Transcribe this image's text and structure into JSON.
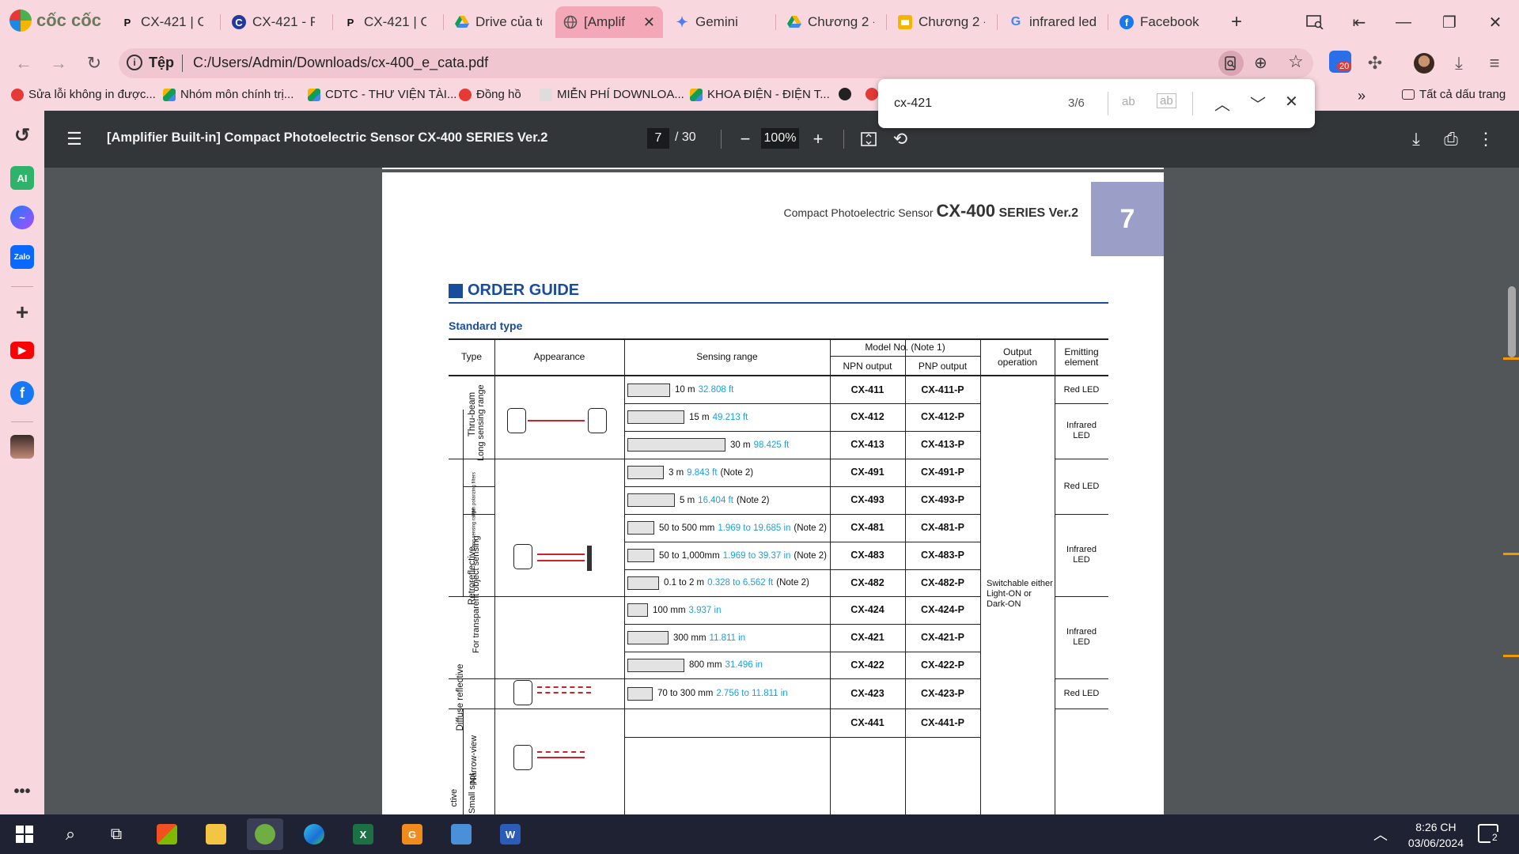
{
  "browser": {
    "logo_text": "cốc cốc",
    "tabs": [
      {
        "label": "CX-421 | Co",
        "icon": "P"
      },
      {
        "label": "CX-421 - Pa",
        "icon": "C"
      },
      {
        "label": "CX-421 | Co",
        "icon": "P"
      },
      {
        "label": "Drive của tô",
        "icon": "drive"
      },
      {
        "label": "[Amplif",
        "icon": "globe",
        "active": true
      },
      {
        "label": "Gemini",
        "icon": "gemini"
      },
      {
        "label": "Chương 2 -",
        "icon": "drive"
      },
      {
        "label": "Chương 2 -",
        "icon": "slides"
      },
      {
        "label": "infrared led",
        "icon": "google"
      },
      {
        "label": "Facebook",
        "icon": "facebook"
      }
    ],
    "address": {
      "site_label": "Tệp",
      "url": "C:/Users/Admin/Downloads/cx-400_e_cata.pdf"
    },
    "extension_badge": "20",
    "bookmarks": [
      "Sửa lỗi không in được...",
      "Nhóm môn chính trị...",
      "CDTC - THƯ VIỆN TÀI...",
      "Đồng hồ",
      "MIỄN PHÍ DOWNLOA...",
      "KHOA ĐIỆN - ĐIỆN T..."
    ],
    "all_bookmarks": "Tất cả dấu trang"
  },
  "find": {
    "query": "cx-421",
    "count": "3/6",
    "opt1": "ab",
    "opt2": "ab"
  },
  "pdf": {
    "title": "[Amplifier Built-in] Compact Photoelectric Sensor CX-400 SERIES Ver.2",
    "page_current": "7",
    "page_total": "/ 30",
    "zoom": "100%"
  },
  "page": {
    "header_small": "Compact Photoelectric Sensor ",
    "header_big": "CX-400",
    "header_series": " SERIES Ver.2",
    "page_number": "7",
    "section_title": "ORDER GUIDE",
    "subsection": "Standard type",
    "columns": {
      "type": "Type",
      "appearance": "Appearance",
      "range": "Sensing range",
      "model": "Model No. (Note 1)",
      "npn": "NPN output",
      "pnp": "PNP output",
      "output": "Output operation",
      "emitting": "Emitting element"
    },
    "groups": {
      "thru": "Thru-beam",
      "long": "Long sensing range",
      "retro": "Retroreflective",
      "polar": "With polarizing filters",
      "longrange": "Long sensing range",
      "transparent": "For transparent object sensing",
      "diffuse": "Diffuse reflective",
      "narrow": "Narrow-view",
      "small": "Small spot",
      "cutoff": "ctive"
    },
    "output_operation": "Switchable either Light-ON or Dark-ON",
    "rows": [
      {
        "range": "10 m",
        "range_ft": "32.808 ft",
        "note": "",
        "npn": "CX-411",
        "pnp": "CX-411-P",
        "bar": 0.27
      },
      {
        "range": "15 m",
        "range_ft": "49.213 ft",
        "note": "",
        "npn": "CX-412",
        "pnp": "CX-412-P",
        "bar": 0.36
      },
      {
        "range": "30 m",
        "range_ft": "98.425 ft",
        "note": "",
        "npn": "CX-413",
        "pnp": "CX-413-P",
        "bar": 0.62
      },
      {
        "range": "3 m",
        "range_ft": "9.843 ft",
        "note": "(Note 2)",
        "npn": "CX-491",
        "pnp": "CX-491-P",
        "bar": 0.23
      },
      {
        "range": "5 m",
        "range_ft": "16.404 ft",
        "note": "(Note 2)",
        "npn": "CX-493",
        "pnp": "CX-493-P",
        "bar": 0.3
      },
      {
        "range": "50 to 500 mm",
        "range_ft": "1.969 to 19.685 in",
        "note": "(Note 2)",
        "npn": "CX-481",
        "pnp": "CX-481-P",
        "bar": 0.17
      },
      {
        "range": "50 to 1,000mm",
        "range_ft": "1.969 to 39.37 in",
        "note": "(Note 2)",
        "npn": "CX-483",
        "pnp": "CX-483-P",
        "bar": 0.17
      },
      {
        "range": "0.1 to 2 m",
        "range_ft": "0.328 to 6.562 ft",
        "note": "(Note 2)",
        "npn": "CX-482",
        "pnp": "CX-482-P",
        "bar": 0.2
      },
      {
        "range": "100 mm",
        "range_ft": "3.937 in",
        "note": "",
        "npn": "CX-424",
        "pnp": "CX-424-P",
        "bar": 0.13
      },
      {
        "range": "300 mm",
        "range_ft": "11.811 in",
        "note": "",
        "npn": "CX-421",
        "pnp": "CX-421-P",
        "bar": 0.26
      },
      {
        "range": "800 mm",
        "range_ft": "31.496 in",
        "note": "",
        "npn": "CX-422",
        "pnp": "CX-422-P",
        "bar": 0.36
      },
      {
        "range": "70 to 300 mm",
        "range_ft": "2.756 to 11.811 in",
        "note": "",
        "npn": "CX-423",
        "pnp": "CX-423-P",
        "bar": 0.16
      },
      {
        "range": "",
        "range_ft": "",
        "note": "",
        "npn": "CX-441",
        "pnp": "CX-441-P",
        "bar": 0
      }
    ],
    "emitting": [
      "Red LED",
      "Infrared LED",
      "Red LED",
      "Infrared LED",
      "Infrared LED",
      "Red LED"
    ]
  },
  "taskbar": {
    "time": "8:26 CH",
    "date": "03/06/2024",
    "notifications": "2"
  }
}
